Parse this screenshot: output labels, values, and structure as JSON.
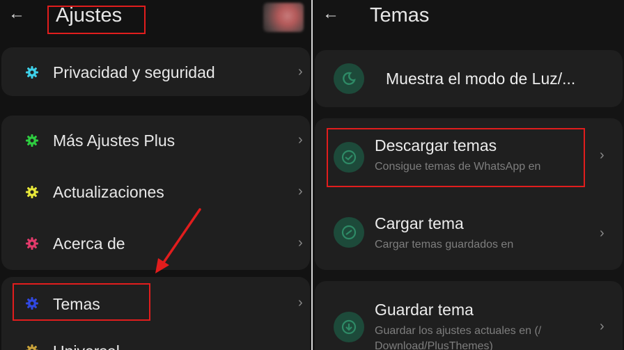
{
  "left": {
    "back_glyph": "←",
    "title": "Ajustes",
    "items": [
      {
        "label": "Privacidad y seguridad",
        "icon": "gear-icon",
        "color": "#3ed0e8"
      },
      {
        "label": "Más Ajustes Plus",
        "icon": "gear-icon",
        "color": "#2ecc40"
      },
      {
        "label": "Actualizaciones",
        "icon": "gear-icon",
        "color": "#e8e83a"
      },
      {
        "label": "Acerca de",
        "icon": "gear-icon",
        "color": "#e23a6a"
      },
      {
        "label": "Temas",
        "icon": "gear-icon",
        "color": "#3048e0"
      },
      {
        "label": "Universal",
        "icon": "gear-icon",
        "color": "#c8a23a"
      }
    ],
    "chevron": "›"
  },
  "right": {
    "back_glyph": "←",
    "title": "Temas",
    "mode_item": {
      "label": "Muestra el modo de Luz/..."
    },
    "items": [
      {
        "title": "Descargar temas",
        "subtitle": "Consigue temas de WhatsApp en"
      },
      {
        "title": "Cargar tema",
        "subtitle": "Cargar temas guardados en"
      },
      {
        "title": "Guardar tema",
        "subtitle": "Guardar los ajustes actuales en (/",
        "subtitle2": "Download/PlusThemes)"
      }
    ],
    "chevron": "›"
  },
  "colors": {
    "accent_green": "#1d4a3a",
    "highlight_red": "#e11d1d",
    "card_bg": "#1f1f1f"
  }
}
